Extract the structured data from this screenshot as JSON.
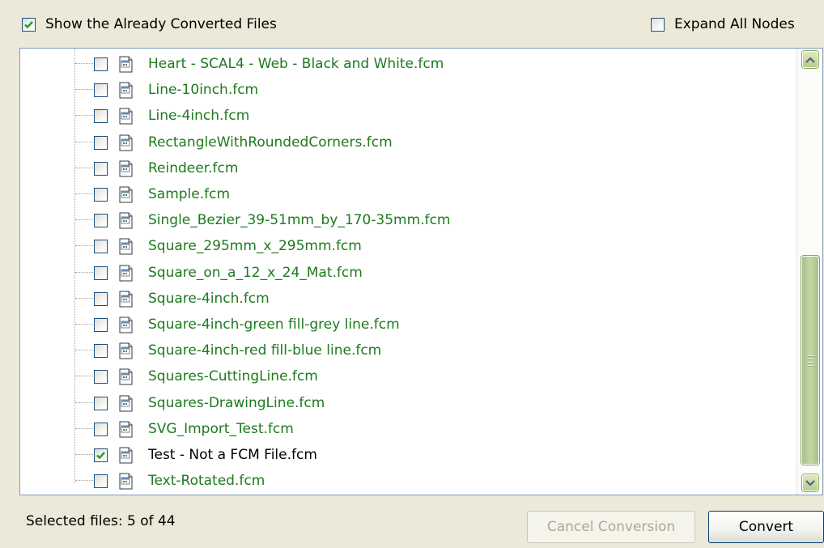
{
  "options": {
    "show_converted": {
      "label": "Show the Already Converted Files",
      "checked": true
    },
    "expand_all": {
      "label": "Expand All Nodes",
      "checked": false
    }
  },
  "files": [
    {
      "name": "Heart - SCAL4 - Web - Black and White.fcm",
      "checked": false,
      "converted": true
    },
    {
      "name": "Line-10inch.fcm",
      "checked": false,
      "converted": true
    },
    {
      "name": "Line-4inch.fcm",
      "checked": false,
      "converted": true
    },
    {
      "name": "RectangleWithRoundedCorners.fcm",
      "checked": false,
      "converted": true
    },
    {
      "name": "Reindeer.fcm",
      "checked": false,
      "converted": true
    },
    {
      "name": "Sample.fcm",
      "checked": false,
      "converted": true
    },
    {
      "name": "Single_Bezier_39-51mm_by_170-35mm.fcm",
      "checked": false,
      "converted": true
    },
    {
      "name": "Square_295mm_x_295mm.fcm",
      "checked": false,
      "converted": true
    },
    {
      "name": "Square_on_a_12_x_24_Mat.fcm",
      "checked": false,
      "converted": true
    },
    {
      "name": "Square-4inch.fcm",
      "checked": false,
      "converted": true
    },
    {
      "name": "Square-4inch-green fill-grey line.fcm",
      "checked": false,
      "converted": true
    },
    {
      "name": "Square-4inch-red fill-blue line.fcm",
      "checked": false,
      "converted": true
    },
    {
      "name": "Squares-CuttingLine.fcm",
      "checked": false,
      "converted": true
    },
    {
      "name": "Squares-DrawingLine.fcm",
      "checked": false,
      "converted": true
    },
    {
      "name": "SVG_Import_Test.fcm",
      "checked": false,
      "converted": true
    },
    {
      "name": "Test - Not a FCM File.fcm",
      "checked": true,
      "converted": false
    },
    {
      "name": "Text-Rotated.fcm",
      "checked": false,
      "converted": true
    }
  ],
  "status": {
    "text": "Selected files: 5 of 44"
  },
  "buttons": {
    "cancel": {
      "label": "Cancel Conversion",
      "enabled": false
    },
    "convert": {
      "label": "Convert",
      "enabled": true
    }
  },
  "colors": {
    "converted_text": "#1d7a1d",
    "normal_text": "#000000",
    "accent": "#7f9db9"
  },
  "icons": {
    "file": "fcm-file-icon",
    "check": "checkmark-icon"
  }
}
